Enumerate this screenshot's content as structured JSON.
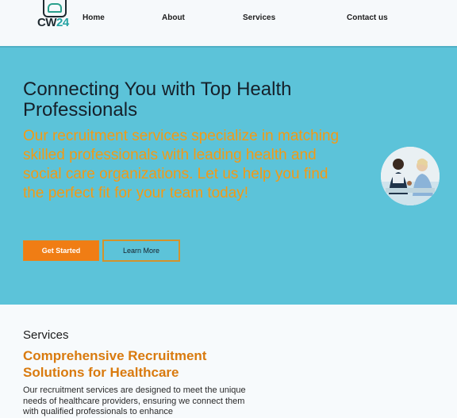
{
  "brand": {
    "logo_text_primary": "CW",
    "logo_text_accent": "24"
  },
  "nav": {
    "items": [
      {
        "label": "Home"
      },
      {
        "label": "About"
      },
      {
        "label": "Services"
      },
      {
        "label": "Contact us"
      }
    ]
  },
  "hero": {
    "title": "Connecting You with Top Health Professionals",
    "tagline": "Our recruitment services specialize in matching skilled professionals with leading health and social care organizations. Let us help you find the perfect fit for your team today!",
    "primary_button": "Get Started",
    "secondary_button": "Learn More"
  },
  "services": {
    "kicker": "Services",
    "title": "Comprehensive Recruitment Solutions for Healthcare",
    "body": "Our recruitment services are designed to meet the unique needs of healthcare providers, ensuring we connect them with qualified professionals to enhance"
  },
  "colors": {
    "hero_bg": "#5cc3d9",
    "accent_orange": "#f07d14",
    "heading_orange": "#d97a0e",
    "tagline_orange": "#f39a14"
  }
}
